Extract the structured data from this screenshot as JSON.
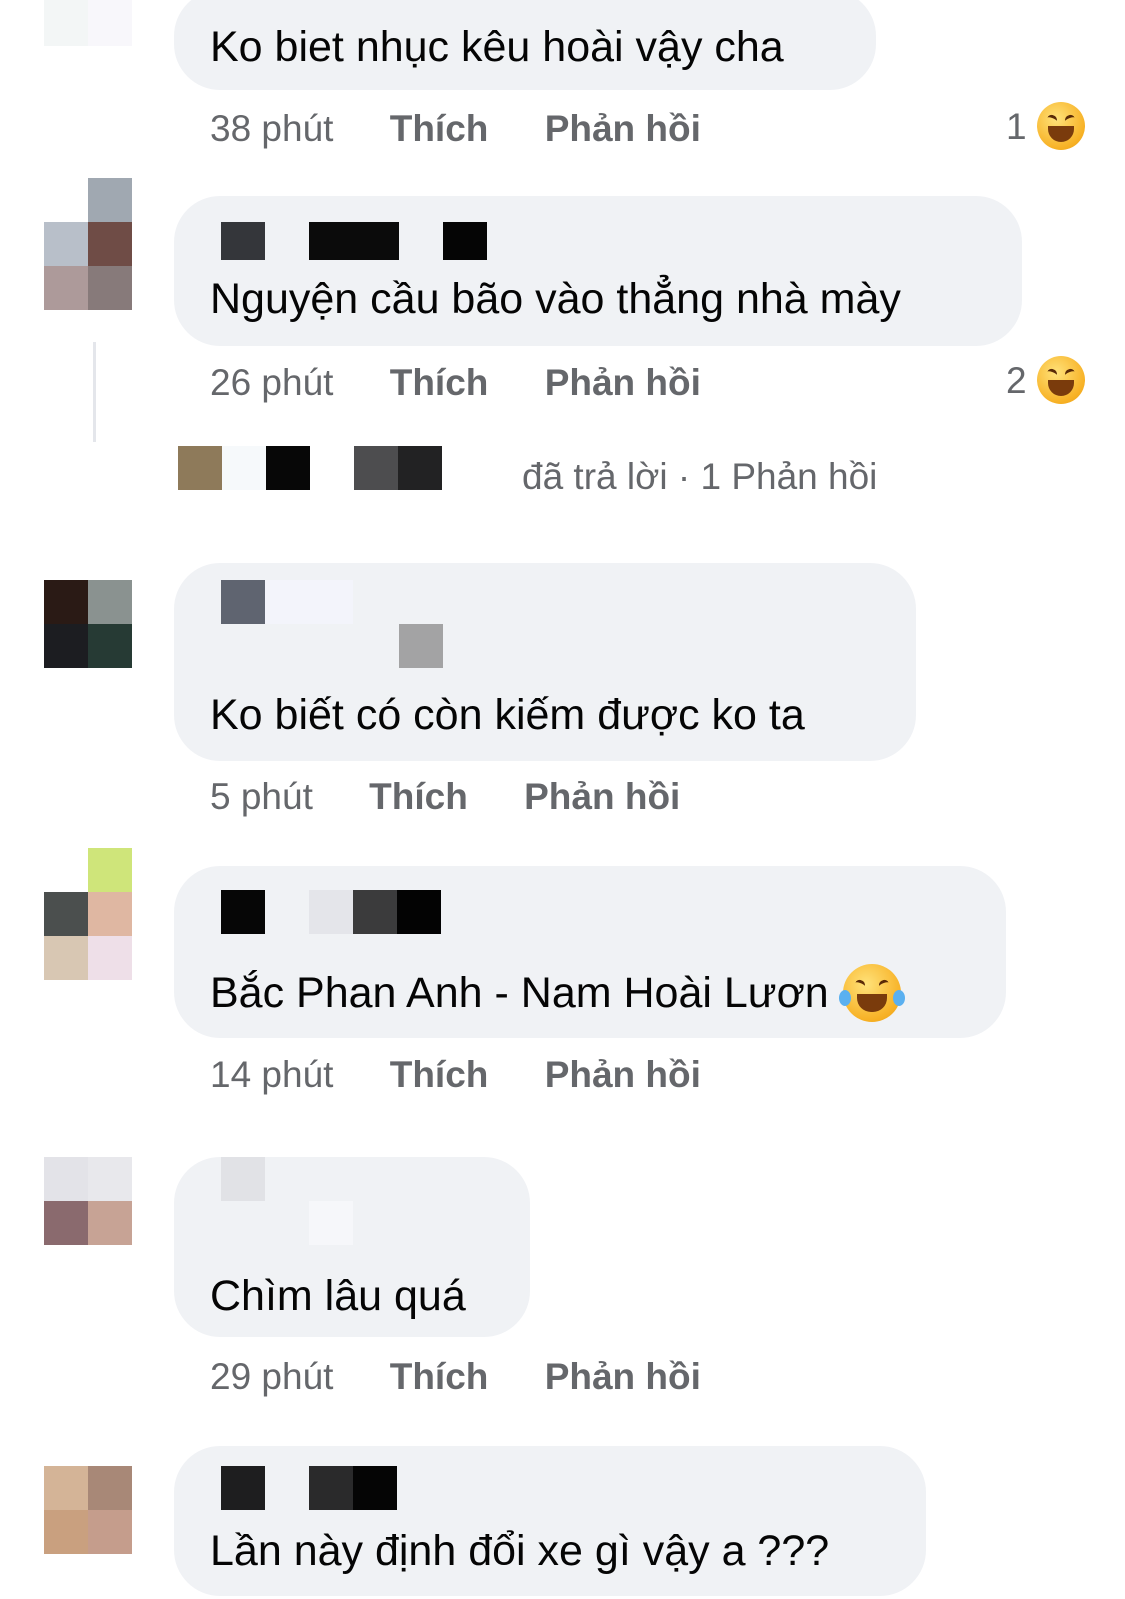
{
  "comments": [
    {
      "text": "Ko biet nhục kêu hoài vậy cha",
      "time": "38 phút",
      "like": "Thích",
      "reply": "Phản hồi",
      "reaction_count": "1",
      "reaction_icon": "laughing-squint-emoji"
    },
    {
      "text": "Nguyện cầu bão vào thẳng nhà mày",
      "time": "26 phút",
      "like": "Thích",
      "reply": "Phản hồi",
      "reaction_count": "2",
      "reaction_icon": "laughing-squint-emoji"
    },
    {
      "text": "Ko biết có còn kiếm được ko ta",
      "time": "5 phút",
      "like": "Thích",
      "reply": "Phản hồi"
    },
    {
      "text": "Bắc Phan Anh - Nam Hoài Lươn",
      "emoji": "tears-of-joy-emoji",
      "time": "14 phút",
      "like": "Thích",
      "reply": "Phản hồi"
    },
    {
      "text": "Chìm lâu quá",
      "time": "29 phút",
      "like": "Thích",
      "reply": "Phản hồi"
    },
    {
      "text": "Lần này định đổi xe gì vậy a ???"
    }
  ],
  "reply_summary": {
    "text": "đã trả lời · 1 Phản hồi"
  }
}
